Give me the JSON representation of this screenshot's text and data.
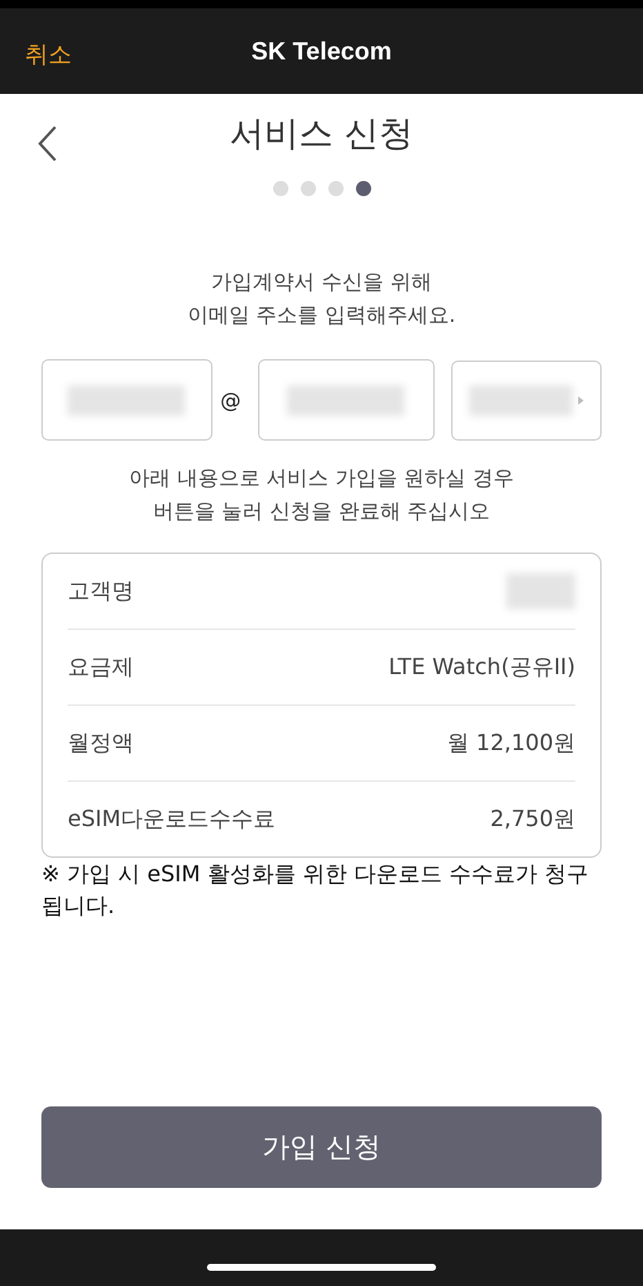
{
  "nav_bar": {
    "cancel": "취소",
    "title": "SK Telecom"
  },
  "page": {
    "title": "서비스 신청"
  },
  "steps": [
    {
      "selected": false
    },
    {
      "selected": false
    },
    {
      "selected": false
    },
    {
      "selected": true
    }
  ],
  "intro": [
    "가입계약서 수신을 위해",
    "이메일 주소를 입력해주세요."
  ],
  "email": {
    "separator": "@",
    "fields": [
      {
        "kind": "input"
      },
      {
        "kind": "input"
      },
      {
        "kind": "select"
      }
    ]
  },
  "instruction": [
    "아래 내용으로 서비스 가입을 원하실 경우",
    "버튼을 눌러 신청을 완료해 주십시오"
  ],
  "summary": [
    {
      "label": "고객명",
      "kind": "blurred"
    },
    {
      "label": "요금제",
      "kind": "text",
      "value": "LTE Watch(공유II)"
    },
    {
      "label": "월정액",
      "kind": "text",
      "value": "월 12,100원"
    },
    {
      "label": "eSIM다운로드수수료",
      "kind": "text",
      "value": "2,750원"
    }
  ],
  "notice": "※ 가입 시 eSIM 활성화를 위한 다운로드 수수료가 청구됩니다.",
  "submit_button": "가입 신청"
}
